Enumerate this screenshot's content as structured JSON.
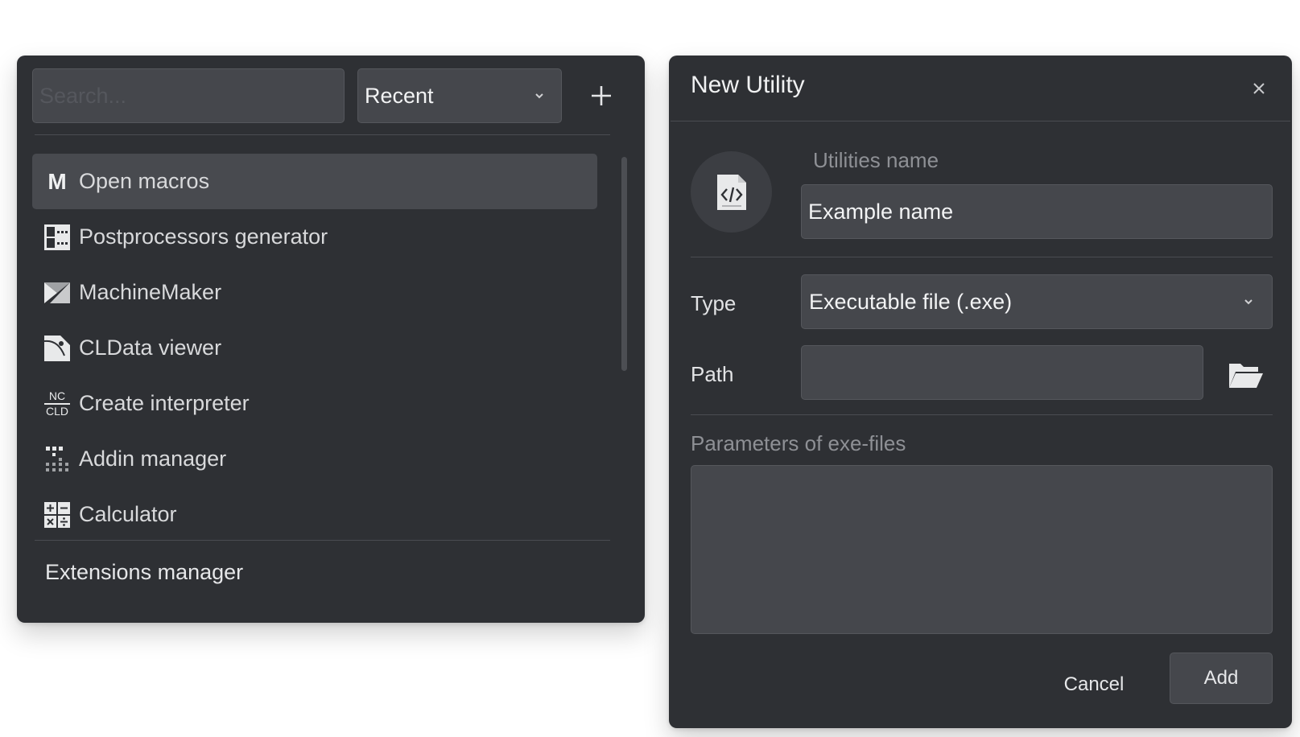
{
  "colors": {
    "panel_bg": "#2e3034",
    "field_bg": "#45474c",
    "selected_bg": "#484a4f",
    "text": "#e4e5e7",
    "muted_text": "#8e9095"
  },
  "left_panel": {
    "search": {
      "placeholder": "Search...",
      "value": ""
    },
    "filter": {
      "selected": "Recent",
      "icon": "chevron-down-icon"
    },
    "add_icon": "plus-icon",
    "items": [
      {
        "label": "Open macros",
        "icon": "macros-m-icon",
        "selected": true
      },
      {
        "label": "Postprocessors generator",
        "icon": "postprocessor-icon"
      },
      {
        "label": "MachineMaker",
        "icon": "machinemaker-icon"
      },
      {
        "label": "CLData viewer",
        "icon": "cldata-viewer-icon"
      },
      {
        "label": "Create interpreter",
        "icon": "nc-cld-icon",
        "icon_text_top": "NC",
        "icon_text_bottom": "CLD"
      },
      {
        "label": "Addin manager",
        "icon": "addin-manager-icon"
      },
      {
        "label": "Calculator",
        "icon": "calculator-icon"
      }
    ],
    "footer_link": "Extensions manager"
  },
  "dialog": {
    "title": "New Utility",
    "close_icon": "close-icon",
    "avatar_icon": "code-file-icon",
    "name_label": "Utilities name",
    "name_value": "Example name",
    "type_label": "Type",
    "type_value": "Executable file (.exe)",
    "path_label": "Path",
    "path_value": "",
    "folder_icon": "open-folder-icon",
    "params_label": "Parameters of exe-files",
    "params_value": "",
    "cancel_label": "Cancel",
    "add_label": "Add"
  }
}
